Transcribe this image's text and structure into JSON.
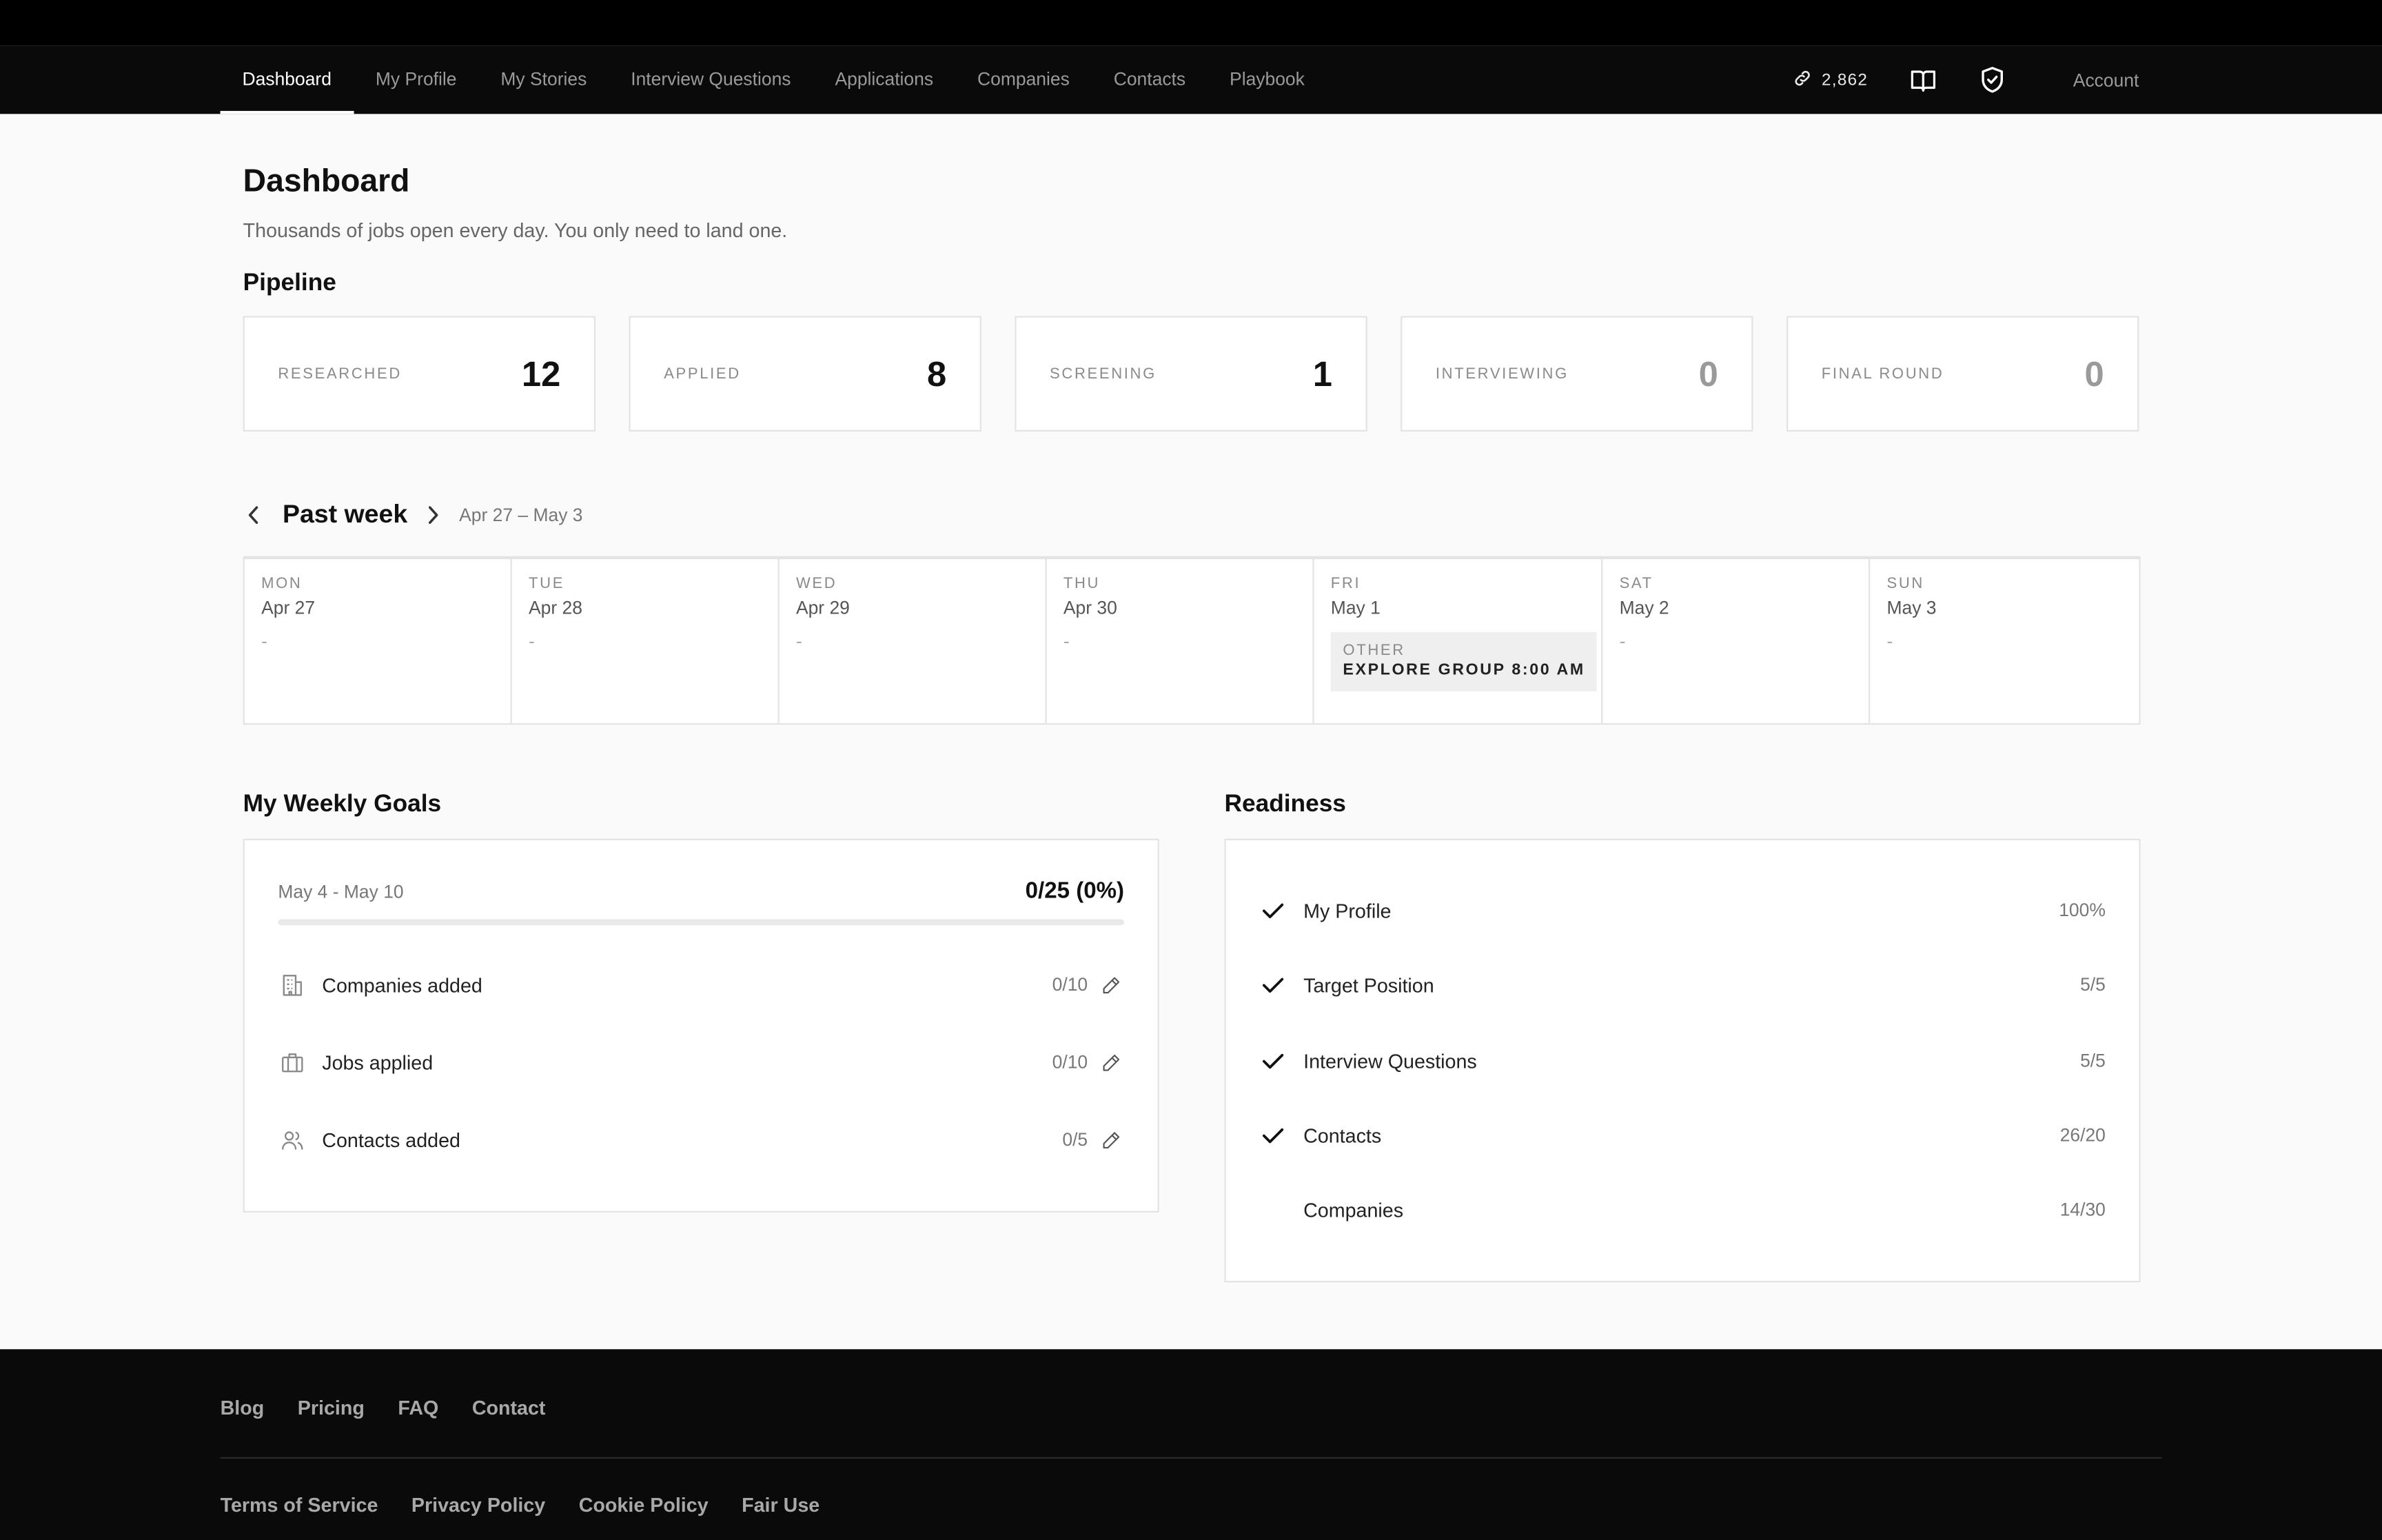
{
  "nav": {
    "links": [
      "Dashboard",
      "My Profile",
      "My Stories",
      "Interview Questions",
      "Applications",
      "Companies",
      "Contacts",
      "Playbook"
    ],
    "active": "Dashboard",
    "credits": "2,862",
    "account": "Account"
  },
  "page": {
    "title": "Dashboard",
    "subtitle": "Thousands of jobs open every day. You only need to land one."
  },
  "pipeline": {
    "heading": "Pipeline",
    "stages": [
      {
        "label": "RESEARCHED",
        "value": "12"
      },
      {
        "label": "APPLIED",
        "value": "8"
      },
      {
        "label": "SCREENING",
        "value": "1"
      },
      {
        "label": "INTERVIEWING",
        "value": "0"
      },
      {
        "label": "FINAL ROUND",
        "value": "0"
      }
    ]
  },
  "week": {
    "title": "Past week",
    "range": "Apr 27 – May 3",
    "days": [
      {
        "name": "MON",
        "date": "Apr 27",
        "empty": "-"
      },
      {
        "name": "TUE",
        "date": "Apr 28",
        "empty": "-"
      },
      {
        "name": "WED",
        "date": "Apr 29",
        "empty": "-"
      },
      {
        "name": "THU",
        "date": "Apr 30",
        "empty": "-"
      },
      {
        "name": "FRI",
        "date": "May 1",
        "event_type": "OTHER",
        "event_title": "EXPLORE GROUP 8:00 AM"
      },
      {
        "name": "SAT",
        "date": "May 2",
        "empty": "-"
      },
      {
        "name": "SUN",
        "date": "May 3",
        "empty": "-"
      }
    ]
  },
  "goals": {
    "heading": "My Weekly Goals",
    "range": "May 4 - May 10",
    "total": "0/25 (0%)",
    "progress": 0,
    "items": [
      {
        "label": "Companies added",
        "count": "0/10",
        "icon": "building-icon"
      },
      {
        "label": "Jobs applied",
        "count": "0/10",
        "icon": "briefcase-icon"
      },
      {
        "label": "Contacts added",
        "count": "0/5",
        "icon": "users-icon"
      }
    ]
  },
  "readiness": {
    "heading": "Readiness",
    "items": [
      {
        "label": "My Profile",
        "value": "100%",
        "done": true
      },
      {
        "label": "Target Position",
        "value": "5/5",
        "done": true
      },
      {
        "label": "Interview Questions",
        "value": "5/5",
        "done": true
      },
      {
        "label": "Contacts",
        "value": "26/20",
        "done": true
      },
      {
        "label": "Companies",
        "value": "14/30",
        "done": false
      }
    ]
  },
  "footer": {
    "row1": [
      "Blog",
      "Pricing",
      "FAQ",
      "Contact"
    ],
    "row2": [
      "Terms of Service",
      "Privacy Policy",
      "Cookie Policy",
      "Fair Use"
    ]
  }
}
